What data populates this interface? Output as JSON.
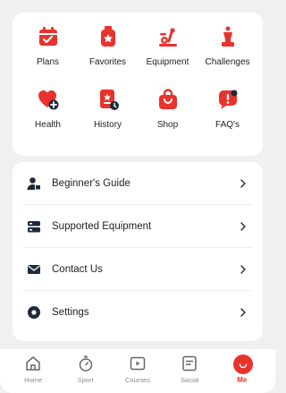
{
  "colors": {
    "accent": "#e8332d",
    "text": "#222222",
    "muted": "#8a8a8a",
    "background": "#f0f0f2"
  },
  "shortcuts": [
    {
      "label": "Plans",
      "icon": "calendar-check-icon"
    },
    {
      "label": "Favorites",
      "icon": "bookmark-star-icon"
    },
    {
      "label": "Equipment",
      "icon": "exercise-bike-icon"
    },
    {
      "label": "Challenges",
      "icon": "trophy-icon"
    },
    {
      "label": "Health",
      "icon": "heart-plus-icon"
    },
    {
      "label": "History",
      "icon": "history-doc-icon"
    },
    {
      "label": "Shop",
      "icon": "shopping-bag-icon"
    },
    {
      "label": "FAQ's",
      "icon": "faq-chat-icon"
    }
  ],
  "menu": [
    {
      "label": "Beginner's Guide",
      "icon": "user-guide-icon"
    },
    {
      "label": "Supported Equipment",
      "icon": "server-icon"
    },
    {
      "label": "Contact Us",
      "icon": "envelope-icon"
    },
    {
      "label": "Settings",
      "icon": "gear-icon"
    }
  ],
  "tabs": [
    {
      "label": "Home",
      "icon": "home-icon"
    },
    {
      "label": "Sport",
      "icon": "stopwatch-icon"
    },
    {
      "label": "Courses",
      "icon": "play-box-icon"
    },
    {
      "label": "Social",
      "icon": "message-icon"
    },
    {
      "label": "Me",
      "icon": "profile-face-icon",
      "active": true
    }
  ]
}
